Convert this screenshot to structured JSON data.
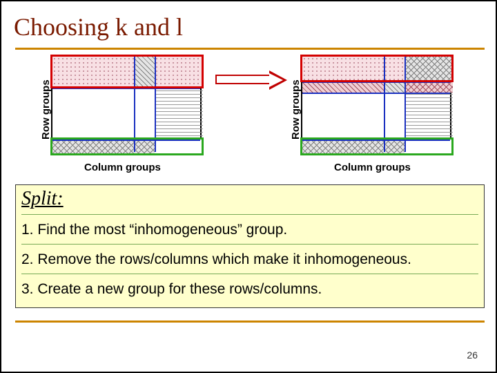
{
  "title": "Choosing k and l",
  "row_label": "Row groups",
  "col_label": "Column groups",
  "split": {
    "heading": "Split:",
    "steps": [
      "1. Find the most “inhomogeneous” group.",
      "2. Remove the rows/columns which make it inhomogeneous.",
      "3. Create a new group for these rows/columns."
    ]
  },
  "page_number": "26"
}
